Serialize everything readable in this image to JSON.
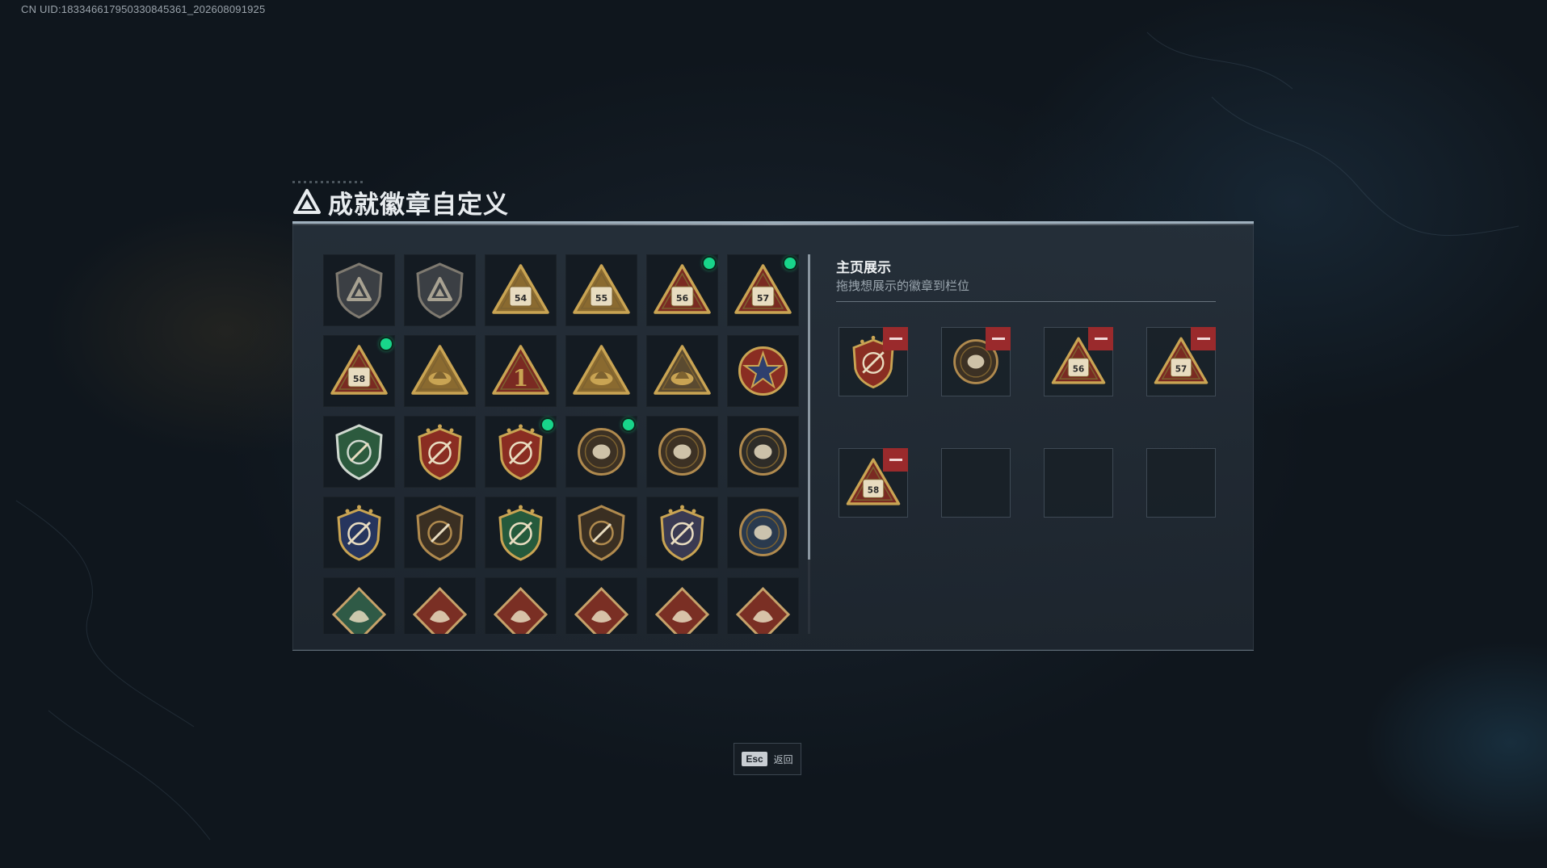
{
  "uid_text": "CN UID:1833466179503308453​61_202608091925",
  "title": "成就徽章自定义",
  "side": {
    "title": "主页展示",
    "subtitle": "拖拽想展示的徽章到栏位"
  },
  "footer": {
    "esc_key": "Esc",
    "esc_label": "返回"
  },
  "colors": {
    "accent_green": "#18d58a",
    "remove_red": "#9a2a2c",
    "gold": "#c9a453"
  },
  "badges": [
    {
      "icon": "shield-triangle-icon",
      "style": "shield-gray",
      "label": "",
      "new": false
    },
    {
      "icon": "helicopter-icon",
      "style": "shield-gray",
      "label": "",
      "new": false
    },
    {
      "icon": "triangle-54-icon",
      "style": "triangle-gold",
      "label": "54",
      "new": false
    },
    {
      "icon": "triangle-55-icon",
      "style": "triangle-gold",
      "label": "55",
      "new": false
    },
    {
      "icon": "triangle-56-icon",
      "style": "triangle-red",
      "label": "56",
      "new": true
    },
    {
      "icon": "triangle-57-icon",
      "style": "triangle-red",
      "label": "57",
      "new": true
    },
    {
      "icon": "triangle-58-icon",
      "style": "triangle-red",
      "label": "58",
      "new": true
    },
    {
      "icon": "triangle-boat-icon",
      "style": "triangle-gold",
      "label": "",
      "new": false
    },
    {
      "icon": "triangle-one-icon",
      "style": "triangle-red",
      "label": "1",
      "new": false
    },
    {
      "icon": "triangle-soldier-icon",
      "style": "triangle-gold",
      "label": "",
      "new": false
    },
    {
      "icon": "triangle-soldiers-icon",
      "style": "triangle-dark",
      "label": "",
      "new": false
    },
    {
      "icon": "star-medal-icon",
      "style": "medal-red",
      "label": "",
      "new": false
    },
    {
      "icon": "green-shield-icon",
      "style": "shield-green",
      "label": "",
      "new": false
    },
    {
      "icon": "crest-shield-icon",
      "style": "crest-red",
      "label": "",
      "new": false
    },
    {
      "icon": "crest-shield-stars-icon",
      "style": "crest-red",
      "label": "",
      "new": true
    },
    {
      "icon": "round-orb-icon",
      "style": "round-bronze",
      "label": "",
      "new": true
    },
    {
      "icon": "round-skull-icon",
      "style": "round-bronze",
      "label": "",
      "new": false
    },
    {
      "icon": "round-eye-icon",
      "style": "round-dark",
      "label": "",
      "new": false
    },
    {
      "icon": "rifle-crest-blue-icon",
      "style": "crest-blue",
      "label": "",
      "new": false
    },
    {
      "icon": "rifle-shield-bronze-icon",
      "style": "shield-bronze",
      "label": "",
      "new": false
    },
    {
      "icon": "rifle-crest-green-icon",
      "style": "crest-green",
      "label": "",
      "new": false
    },
    {
      "icon": "sniper-shield-icon",
      "style": "shield-bronze",
      "label": "",
      "new": false
    },
    {
      "icon": "rifle-crest-gold-icon",
      "style": "crest-gold",
      "label": "",
      "new": false
    },
    {
      "icon": "eagle-round-icon",
      "style": "round-blue",
      "label": "",
      "new": false
    },
    {
      "icon": "diamond-rocket-icon",
      "style": "diamond-green",
      "label": "",
      "new": false
    },
    {
      "icon": "diamond-dragon-icon",
      "style": "diamond-red",
      "label": "",
      "new": false
    },
    {
      "icon": "diamond-dragon-2-icon",
      "style": "diamond-red",
      "label": "",
      "new": false
    },
    {
      "icon": "diamond-runner-icon",
      "style": "diamond-red",
      "label": "",
      "new": false
    },
    {
      "icon": "diamond-beast-icon",
      "style": "diamond-red",
      "label": "",
      "new": false
    },
    {
      "icon": "diamond-beast-2-icon",
      "style": "diamond-red",
      "label": "",
      "new": false
    }
  ],
  "slots": [
    {
      "icon": "crest-shield-stars-icon",
      "style": "crest-red",
      "label": "",
      "filled": true
    },
    {
      "icon": "round-orb-icon",
      "style": "round-bronze",
      "label": "",
      "filled": true
    },
    {
      "icon": "triangle-56-icon",
      "style": "triangle-red",
      "label": "56",
      "filled": true
    },
    {
      "icon": "triangle-57-icon",
      "style": "triangle-red",
      "label": "57",
      "filled": true
    },
    {
      "icon": "triangle-58-icon",
      "style": "triangle-red",
      "label": "58",
      "filled": true
    },
    {
      "icon": "",
      "style": "",
      "label": "",
      "filled": false
    },
    {
      "icon": "",
      "style": "",
      "label": "",
      "filled": false
    },
    {
      "icon": "",
      "style": "",
      "label": "",
      "filled": false
    }
  ]
}
